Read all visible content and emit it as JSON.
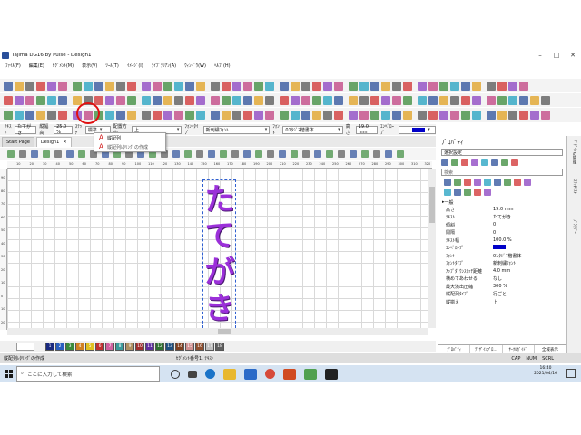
{
  "window": {
    "title": "Tajima DG16 by Pulse - Design1"
  },
  "menus": [
    "ﾌｧｲﾙ(F)",
    "編集(E)",
    "ｾｸﾞﾒﾝﾄ(M)",
    "表示(V)",
    "ﾂｰﾙ(T)",
    "ｲﾒｰｼﾞ(I)",
    "ﾗｲﾌﾞﾗﾘｱﾝ(A)",
    "ｳｨﾝﾄﾞｳ(W)",
    "ﾍﾙﾌﾟ(H)"
  ],
  "propbar": {
    "text_label": "ﾃｷｽﾄ",
    "text_value": "たてがき",
    "height_label": "縦幅高",
    "height_value": "25.0 %",
    "stitch_label": "ｽﾃｯﾁ",
    "stitch_value": "標準",
    "dir_label": "配置方向",
    "dir_value": "上",
    "fonttype_label": "ﾌｫﾝﾄﾀｲﾌﾟ",
    "fonttype_value": "新刺繍ﾌｫﾝﾄ",
    "font_label": "ﾌｫﾝﾄ",
    "font_value": "01ﾀｼﾞﾏ楷書体",
    "size_label": "高さ",
    "size_value": "19.0 mm",
    "envelope_label": "ｴﾝﾍﾞﾛｰﾌﾟ",
    "envelope_color": "#0000c8"
  },
  "tabs": [
    {
      "label": "Start Page"
    },
    {
      "label": "Design1"
    }
  ],
  "popup": {
    "items": [
      "縦配列",
      "縦配列ﾚﾀﾘﾝｸﾞの作成"
    ]
  },
  "ruler": {
    "h_labels": [
      "10",
      "20",
      "30",
      "40",
      "50",
      "60",
      "70",
      "80",
      "90",
      "100",
      "110",
      "120",
      "130",
      "140",
      "150",
      "160",
      "170",
      "180",
      "190",
      "200",
      "210",
      "220",
      "230",
      "240",
      "250",
      "260",
      "270",
      "280",
      "290",
      "300",
      "310",
      "320"
    ],
    "v_labels": [
      "90",
      "80",
      "70",
      "60",
      "50",
      "40",
      "30",
      "20",
      "10",
      "0",
      "10",
      "20"
    ]
  },
  "design": {
    "chars": [
      "た",
      "て",
      "が",
      "き"
    ],
    "color": "#9b30d9"
  },
  "colorbar": {
    "numbers": [
      "1",
      "2",
      "3",
      "4",
      "5",
      "6",
      "7",
      "8",
      "9",
      "10",
      "11",
      "12",
      "13",
      "14",
      "15",
      "16",
      "17",
      "18"
    ],
    "colors": [
      "#1a2a80",
      "#2a5fbf",
      "#3a8a3a",
      "#d08020",
      "#e0c020",
      "#c03030",
      "#d060a0",
      "#3a9a9a",
      "#b09060",
      "#a03030",
      "#6030a0",
      "#307030",
      "#205080",
      "#804020",
      "#d09090",
      "#905030",
      "#c0c0c0",
      "#606060"
    ]
  },
  "status": {
    "left": "縦配列ﾚﾀﾘﾝｸﾞの作成",
    "middle": "ｾｸﾞﾒﾝﾄ番号1, ﾃｷｽﾄ",
    "caps": "CAP",
    "num": "NUM",
    "scroll": "SCRL"
  },
  "props": {
    "title": "ﾌﾟﾛﾊﾟﾃｨ",
    "selection": "選択設定",
    "search_placeholder": "検索",
    "group": "一般",
    "rows": [
      {
        "k": "高さ",
        "v": "19.0 mm"
      },
      {
        "k": "ﾃｷｽﾄ",
        "v": "たてがき"
      },
      {
        "k": "傾斜",
        "v": "0"
      },
      {
        "k": "間隔",
        "v": "0"
      },
      {
        "k": "ﾃｷｽﾄ幅",
        "v": "100.0 %"
      },
      {
        "k": "ｴﾝﾍﾞﾛｰﾌﾟ",
        "v": ""
      },
      {
        "k": "ﾌｫﾝﾄ",
        "v": "01ﾀｼﾞﾏ楷書体"
      },
      {
        "k": "ﾌｫﾝﾄﾀｲﾌﾟ",
        "v": "新刺繍ﾌｫﾝﾄ"
      },
      {
        "k": "ｱｯﾌﾟﾀﾞｳﾝｽﾃｯﾁ距離",
        "v": "4.0 mm"
      },
      {
        "k": "横めてあわせる",
        "v": "なし"
      },
      {
        "k": "最大演出圧縮",
        "v": "300 %"
      },
      {
        "k": "縦配列ﾀｲﾌﾟ",
        "v": "行ごと"
      },
      {
        "k": "縦揃え",
        "v": "上"
      }
    ],
    "bottom_tabs": [
      "ﾌﾟﾛﾊﾟﾃｨ",
      "ﾃﾞｻﾞｲﾝﾌﾟﾛ...",
      "ｻｰｸﾙｶﾞｲﾄﾞ",
      "全域表示"
    ]
  },
  "sidetabs": [
    "ﾃﾞｻﾞｲﾝの管理",
    "ｽﾃｯﾁﾘｽﾄ",
    "ﾌﾞﾗｳｻﾞｰ"
  ],
  "taskbar": {
    "search_placeholder": "ここに入力して検索",
    "time": "16:40",
    "date": "2021/04/16"
  }
}
